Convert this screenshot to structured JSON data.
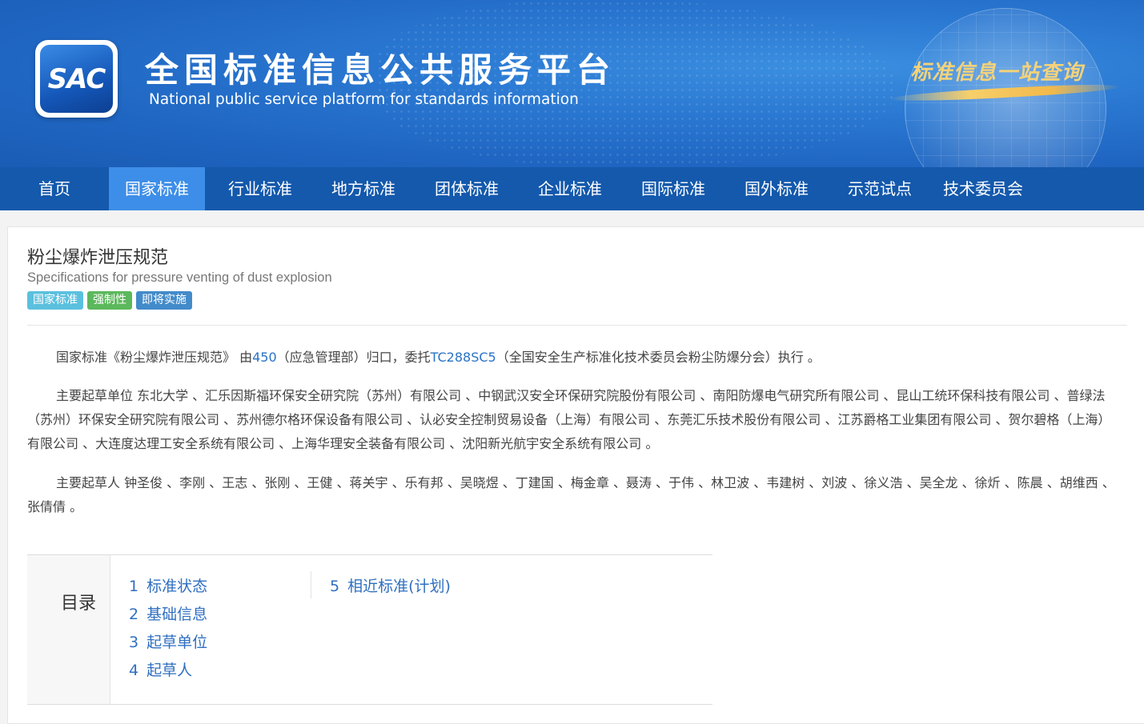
{
  "header": {
    "logo_text": "SAC",
    "site_title": "全国标准信息公共服务平台",
    "site_subtitle": "National public service platform  for standards information",
    "slogan": "标准信息一站查询"
  },
  "nav": {
    "items": [
      {
        "label": "首页"
      },
      {
        "label": "国家标准"
      },
      {
        "label": "行业标准"
      },
      {
        "label": "地方标准"
      },
      {
        "label": "团体标准"
      },
      {
        "label": "企业标准"
      },
      {
        "label": "国际标准"
      },
      {
        "label": "国外标准"
      },
      {
        "label": "示范试点"
      },
      {
        "label": "技术委员会"
      }
    ],
    "active": "国家标准"
  },
  "standard": {
    "title_cn": "粉尘爆炸泄压规范",
    "title_en": "Specifications for pressure venting of dust explosion",
    "badges": [
      {
        "label": "国家标准",
        "color": "#5bc0de"
      },
      {
        "label": "强制性",
        "color": "#5cb85c"
      },
      {
        "label": "即将实施",
        "color": "#428bca"
      }
    ]
  },
  "description": {
    "p1_prefix": "国家标准《粉尘爆炸泄压规范》 由",
    "p1_code": "450",
    "p1_mid": "（应急管理部）归口，委托",
    "p1_tc": "TC288SC5",
    "p1_suffix": "（全国安全生产标准化技术委员会粉尘防爆分会）执行 。",
    "p2": "主要起草单位 东北大学 、汇乐因斯福环保安全研究院（苏州）有限公司 、中钢武汉安全环保研究院股份有限公司 、南阳防爆电气研究所有限公司 、昆山工统环保科技有限公司 、普绿法（苏州）环保安全研究院有限公司 、苏州德尔格环保设备有限公司 、认必安全控制贸易设备（上海）有限公司 、东莞汇乐技术股份有限公司 、江苏爵格工业集团有限公司 、贺尔碧格（上海）有限公司 、大连度达理工安全系统有限公司 、上海华理安全装备有限公司 、沈阳新光航宇安全系统有限公司 。",
    "p3": "主要起草人 钟圣俊 、李刚 、王志 、张刚 、王健 、蒋关宇 、乐有邦 、吴晓煜 、丁建国 、梅金章 、聂涛 、于伟 、林卫波 、韦建树 、刘波 、徐义浩 、吴全龙 、徐炘 、陈晨 、胡维西 、张倩倩 。"
  },
  "toc": {
    "label": "目录",
    "items": [
      {
        "num": "1",
        "label": "标准状态"
      },
      {
        "num": "2",
        "label": "基础信息"
      },
      {
        "num": "3",
        "label": "起草单位"
      },
      {
        "num": "4",
        "label": "起草人"
      },
      {
        "num": "5",
        "label": "相近标准(计划)"
      }
    ]
  }
}
